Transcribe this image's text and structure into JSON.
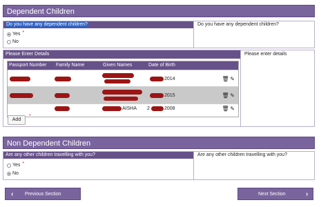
{
  "section1": {
    "title": "Dependent Children",
    "question": "Do you have any dependent children?",
    "help": "Do you have any dependent children?",
    "options": [
      "Yes",
      "No"
    ],
    "selected": "Yes",
    "required_mark": "*"
  },
  "details": {
    "header": "Please Enter Details",
    "help": "Please enter details",
    "columns": [
      "Passport Number",
      "Family Name",
      "Given Names",
      "Date of Birth"
    ],
    "rows": [
      {
        "given_suffix": "",
        "dob_suffix": "2014"
      },
      {
        "given_suffix": "",
        "dob_suffix": "2015"
      },
      {
        "given_suffix": "AISHA",
        "dob_prefix": "2",
        "dob_suffix": "2008"
      }
    ],
    "add_label": "Add",
    "required_mark": "*",
    "delete_icon": "trash-icon",
    "edit_icon": "pencil-icon"
  },
  "section2": {
    "title": "Non Dependent Children",
    "question": "Are any other children travelling with you?",
    "help": "Are any other children travelling with you?",
    "options": [
      "Yes",
      "No"
    ],
    "selected": "No",
    "required_mark": "*"
  },
  "nav": {
    "prev_label": "Previous Section",
    "next_label": "Next Section",
    "prev_icon": "chevron-left-icon",
    "next_icon": "chevron-right-icon"
  },
  "colors": {
    "banner": "#7a649e",
    "header": "#675189",
    "highlight": "#2d63c6",
    "redaction": "#9c1515"
  }
}
